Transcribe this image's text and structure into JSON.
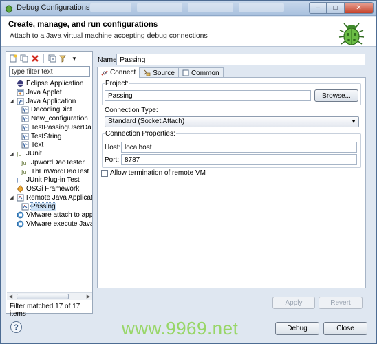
{
  "window": {
    "title": "Debug Configurations",
    "controls": {
      "minimize": "‒",
      "maximize": "□",
      "close": "✕"
    }
  },
  "header": {
    "title": "Create, manage, and run configurations",
    "subtitle": "Attach to a Java virtual machine accepting debug connections",
    "icon": "bug-icon",
    "icon_color": "#5ea83b"
  },
  "left_pane": {
    "toolbar_icons": [
      "new-configuration-icon",
      "duplicate-icon",
      "delete-icon",
      "collapse-all-icon",
      "filter-icon"
    ],
    "filter_placeholder": "type filter text",
    "tree": [
      {
        "label": "Eclipse Application",
        "level": 1,
        "icon": "eclipse-icon",
        "expanded": null
      },
      {
        "label": "Java Applet",
        "level": 1,
        "icon": "applet-icon",
        "expanded": null
      },
      {
        "label": "Java Application",
        "level": 1,
        "icon": "java-app-icon",
        "expanded": true
      },
      {
        "label": "DecodingDict",
        "level": 2,
        "icon": "java-app-icon",
        "expanded": null
      },
      {
        "label": "New_configuration",
        "level": 2,
        "icon": "java-app-icon",
        "expanded": null
      },
      {
        "label": "TestPassingUserDa",
        "level": 2,
        "icon": "java-app-icon",
        "expanded": null
      },
      {
        "label": "TestString",
        "level": 2,
        "icon": "java-app-icon",
        "expanded": null
      },
      {
        "label": "Text",
        "level": 2,
        "icon": "java-app-icon",
        "expanded": null
      },
      {
        "label": "JUnit",
        "level": 1,
        "icon": "junit-icon",
        "expanded": true
      },
      {
        "label": "JpwordDaoTester",
        "level": 2,
        "icon": "junit-icon",
        "expanded": null
      },
      {
        "label": "TbEnWordDaoTest",
        "level": 2,
        "icon": "junit-icon",
        "expanded": null
      },
      {
        "label": "JUnit Plug-in Test",
        "level": 1,
        "icon": "junit-plugin-icon",
        "expanded": null
      },
      {
        "label": "OSGi Framework",
        "level": 1,
        "icon": "osgi-icon",
        "expanded": null
      },
      {
        "label": "Remote Java Applicatio",
        "level": 1,
        "icon": "remote-java-icon",
        "expanded": true
      },
      {
        "label": "Passing",
        "level": 2,
        "icon": "remote-java-icon",
        "expanded": null,
        "selected": true
      },
      {
        "label": "VMware attach to appl",
        "level": 1,
        "icon": "vmware-icon",
        "expanded": null
      },
      {
        "label": "VMware execute Java a",
        "level": 1,
        "icon": "vmware-icon",
        "expanded": null
      }
    ],
    "status": "Filter matched 17 of 17 items"
  },
  "config": {
    "name_label": "Name:",
    "name_value": "Passing",
    "tabs": [
      {
        "label": "Connect",
        "icon": "connect-icon",
        "active": true
      },
      {
        "label": "Source",
        "icon": "source-icon",
        "active": false
      },
      {
        "label": "Common",
        "icon": "common-icon",
        "active": false
      }
    ],
    "project_label": "Project:",
    "project_value": "Passing",
    "browse_label": "Browse...",
    "connection_type_label": "Connection Type:",
    "connection_type_value": "Standard (Socket Attach)",
    "connection_props_label": "Connection Properties:",
    "host_label": "Host:",
    "host_value": "localhost",
    "port_label": "Port:",
    "port_value": "8787",
    "allow_termination_label": "Allow termination of remote VM",
    "allow_termination_checked": false,
    "apply_label": "Apply",
    "revert_label": "Revert"
  },
  "footer": {
    "help_glyph": "?",
    "debug_label": "Debug",
    "close_label": "Close"
  },
  "watermark": "www.9969.net"
}
